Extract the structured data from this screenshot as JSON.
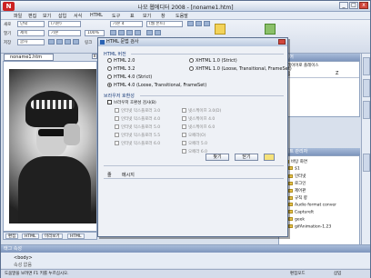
{
  "window": {
    "title": "나모 웹에디터 2008 - [noname1.htm]",
    "app_icon_text": "N"
  },
  "menu": [
    "파일",
    "편집",
    "보기",
    "삽입",
    "서식",
    "HTML",
    "도구",
    "표",
    "보기",
    "창",
    "도움말"
  ],
  "toolbar": {
    "new_label": "새로",
    "open_label": "열기",
    "save_label": "저장",
    "font_label": "(기본)",
    "style_label": "기본",
    "size_label": "기본 4",
    "font_face": "(웹 폰트)",
    "zoom": "100%",
    "para_label": "단락",
    "format_label": "제목",
    "char_label": "글자",
    "link_label": "링크"
  },
  "document": {
    "tab_name": "noname1.htm",
    "close": "x"
  },
  "editor_tabs": [
    "편집",
    "HTML",
    "미리보기",
    "HTML",
    "미리보기"
  ],
  "dialog": {
    "title": "HTML 문법 검사",
    "section_version": "HTML 버전",
    "versions": [
      {
        "label": "HTML 2.0",
        "selected": false
      },
      {
        "label": "XHTML 1.0 (Strict)",
        "selected": false
      },
      {
        "label": "HTML 3.2",
        "selected": false
      },
      {
        "label": "XHTML 1.0 (Loose, Transitional, FrameSet)",
        "selected": false
      },
      {
        "label": "HTML 4.0 (Strict)",
        "selected": false
      },
      {
        "label": "HTML 4.0 (Loose, Transitional, FrameSet)",
        "selected": true
      }
    ],
    "section_browser": "브라우저 호환성",
    "browser_check_label": "브라우저 호환성 검사(B)",
    "browsers_left": [
      "인터넷 익스플로러 3.0",
      "인터넷 익스플로러 4.0",
      "인터넷 익스플로러 5.0",
      "인터넷 익스플로러 5.5",
      "인터넷 익스플로러 6.0"
    ],
    "browsers_right": [
      "넷스케이프 3.0(D)",
      "넷스케이프 4.0",
      "넷스케이프 6.0",
      "오페라(O)",
      "오페라 5.0",
      "오페라 6.0"
    ],
    "check_button": "찾기",
    "close_button": "닫기",
    "results_col_line": "줄",
    "results_col_msg": "메시지"
  },
  "panels": {
    "layer_title": "레이어",
    "layer_check": "레이어로 플레이스",
    "layer_cols": [
      "이름",
      "Z"
    ],
    "site_title": "사이트 관리자",
    "tree": [
      "바탕 화면",
      "$1",
      "인터넷",
      "로그인",
      "제어판",
      "규칙 향",
      "Audio format conver",
      "CaptureIt",
      "geek",
      "gifAnimation-1.23"
    ]
  },
  "tag_inspector": {
    "title": "태그 속성",
    "path": "<body>",
    "prop": "속성 없음"
  },
  "status": {
    "left": "도움말을 보려면 F1 키를 누르십시오.",
    "mode": "편집모드",
    "ins": "삽입"
  },
  "colors": {
    "accent": "#2a62b3",
    "close": "#d2473c"
  }
}
